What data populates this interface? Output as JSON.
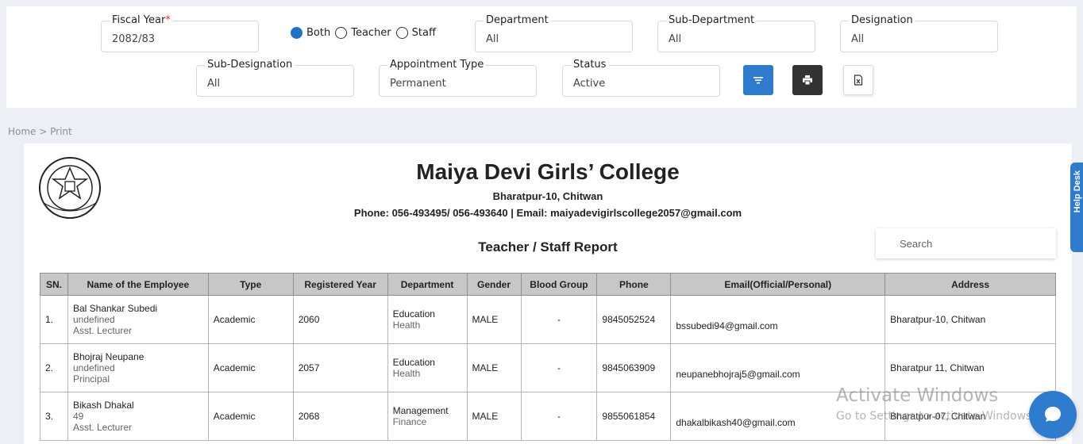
{
  "filters": {
    "fiscal_year": {
      "label": "Fiscal Year",
      "required_mark": "*",
      "value": "2082/83"
    },
    "employee_type": {
      "options": [
        "Both",
        "Teacher",
        "Staff"
      ],
      "selected": "Both"
    },
    "department": {
      "label": "Department",
      "value": "All"
    },
    "sub_department": {
      "label": "Sub-Department",
      "value": "All"
    },
    "designation": {
      "label": "Designation",
      "value": "All"
    },
    "sub_designation": {
      "label": "Sub-Designation",
      "value": "All"
    },
    "appointment_type": {
      "label": "Appointment Type",
      "value": "Permanent"
    },
    "status": {
      "label": "Status",
      "value": "Active"
    }
  },
  "breadcrumb": "Home > Print",
  "report": {
    "college_name": "Maiya Devi Girls’ College",
    "address": "Bharatpur-10, Chitwan",
    "contact": "Phone: 056-493495/ 056-493640 | Email: maiyadevigirlscollege2057@gmail.com",
    "title": "Teacher / Staff Report",
    "search_placeholder": "Search"
  },
  "table": {
    "columns": [
      "SN.",
      "Name of the Employee",
      "Type",
      "Registered Year",
      "Department",
      "Gender",
      "Blood Group",
      "Phone",
      "Email(Official/Personal)",
      "Address"
    ],
    "rows": [
      {
        "sn": "1.",
        "name": "Bal Shankar Subedi",
        "code": "undefined",
        "designation": "Asst. Lecturer",
        "type": "Academic",
        "year": "2060",
        "department": "Education",
        "sub_department": "Health",
        "gender": "MALE",
        "blood_group": "-",
        "phone": "9845052524",
        "email": "bssubedi94@gmail.com",
        "address": "Bharatpur-10, Chitwan"
      },
      {
        "sn": "2.",
        "name": "Bhojraj Neupane",
        "code": "undefined",
        "designation": "Principal",
        "type": "Academic",
        "year": "2057",
        "department": "Education",
        "sub_department": "Health",
        "gender": "MALE",
        "blood_group": "-",
        "phone": "9845063909",
        "email": "neupanebhojraj5@gmail.com",
        "address": "Bharatpur 11, Chitwan"
      },
      {
        "sn": "3.",
        "name": "Bikash Dhakal",
        "code": "49",
        "designation": "Asst. Lecturer",
        "type": "Academic",
        "year": "2068",
        "department": "Management",
        "sub_department": "Finance",
        "gender": "MALE",
        "blood_group": "-",
        "phone": "9855061854",
        "email": "dhakalbikash40@gmail.com",
        "address": "Bharatpur-07, Chitwan"
      }
    ]
  },
  "help_desk_label": "Help Desk",
  "watermark": {
    "line1": "Activate Windows",
    "line2": "Go to Settings to activate Windows."
  },
  "colors": {
    "primary": "#2f7bcd",
    "dark_button": "#333333",
    "header_bg": "#c7c7c7"
  }
}
